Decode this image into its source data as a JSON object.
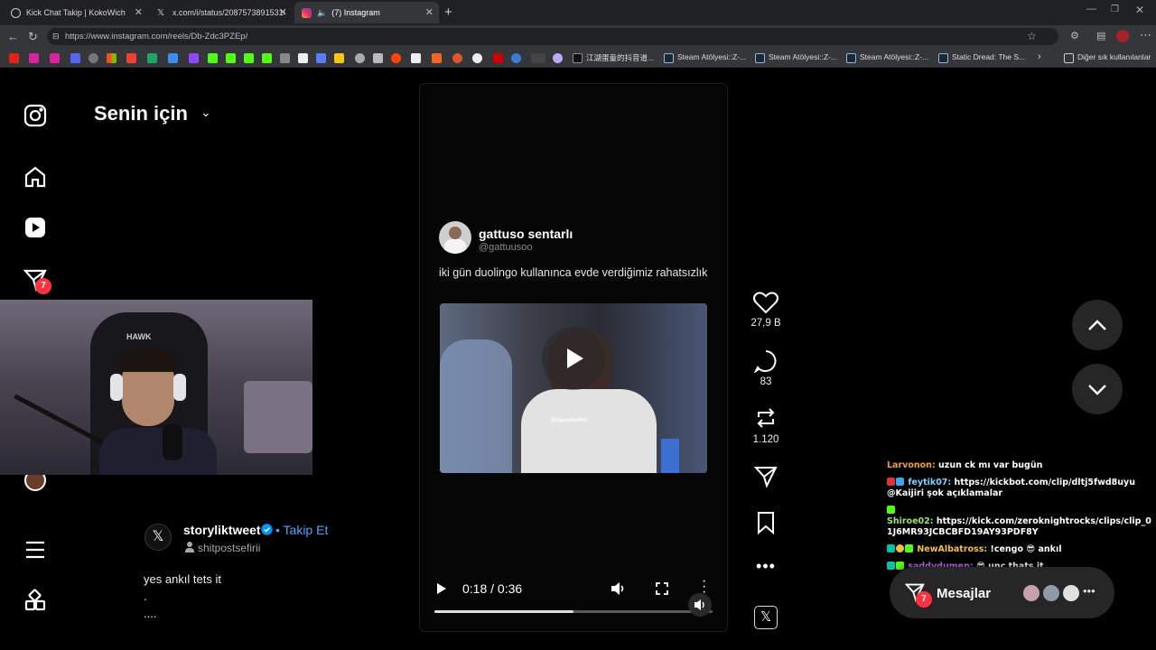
{
  "browser": {
    "tabs": [
      {
        "title": "Kick Chat Takip | KokoWich",
        "active": false
      },
      {
        "title": "x.com/i/status/2087573891531059",
        "active": false
      },
      {
        "title": "(7) Instagram",
        "active": true
      }
    ],
    "url": "https://www.instagram.com/reels/Db-Zdc3PZEp/",
    "bookmarks": [
      {
        "label": "江湖蛋童的抖音道..."
      },
      {
        "label": "Steam Atölyesi::Z-..."
      },
      {
        "label": "Steam Atölyesi::Z-..."
      },
      {
        "label": "Steam Atölyesi::Z-..."
      },
      {
        "label": "Static Dread: The S..."
      }
    ],
    "other_bookmarks": "Diğer sık kullanılanlar"
  },
  "sidebar": {
    "notification_count": "7"
  },
  "feed": {
    "title": "Senin için"
  },
  "tweet": {
    "name": "gattuso sentarlı",
    "handle": "@gattuusoo",
    "text": "iki gün duolingo kullanınca evde verdiğimiz rahatsızlık",
    "watermark": "Shitpostsefirii"
  },
  "player": {
    "time": "0:18 / 0:36",
    "progress": 0.5
  },
  "actions": {
    "likes": "27,9 B",
    "comments": "83",
    "reposts": "1.120"
  },
  "author": {
    "name": "storyliktweet",
    "follow": "• Takip Et",
    "sub": "shitpostsefirii",
    "caption": "yes ankıl tets it\n.\n...."
  },
  "chat": [
    {
      "user": "Larvonon:",
      "user_color": "#f0a030",
      "msg": "uzun ck mı var bugün"
    },
    {
      "user": "feytik07:",
      "user_color": "#7fd1ff",
      "msg": "https://kickbot.com/clip/dltj5fwd8uyu @Kaijiri şok açıklamalar"
    },
    {
      "user": "Shiroe02:",
      "user_color": "#9be36b",
      "msg": "https://kick.com/zeroknightrocks/clips/clip_01J6MR93JCBCBFD19AY93PDF8Y"
    },
    {
      "user": "NewAlbatross:",
      "user_color": "#f0c040",
      "msg": "!cengo 😎 ankıl"
    },
    {
      "user": "saddydumen:",
      "user_color": "#d070ff",
      "msg": "😎 unc thats it"
    }
  ],
  "messages": {
    "label": "Mesajlar",
    "count": "7"
  },
  "webcam": {
    "chair_brand": "HAWK"
  }
}
